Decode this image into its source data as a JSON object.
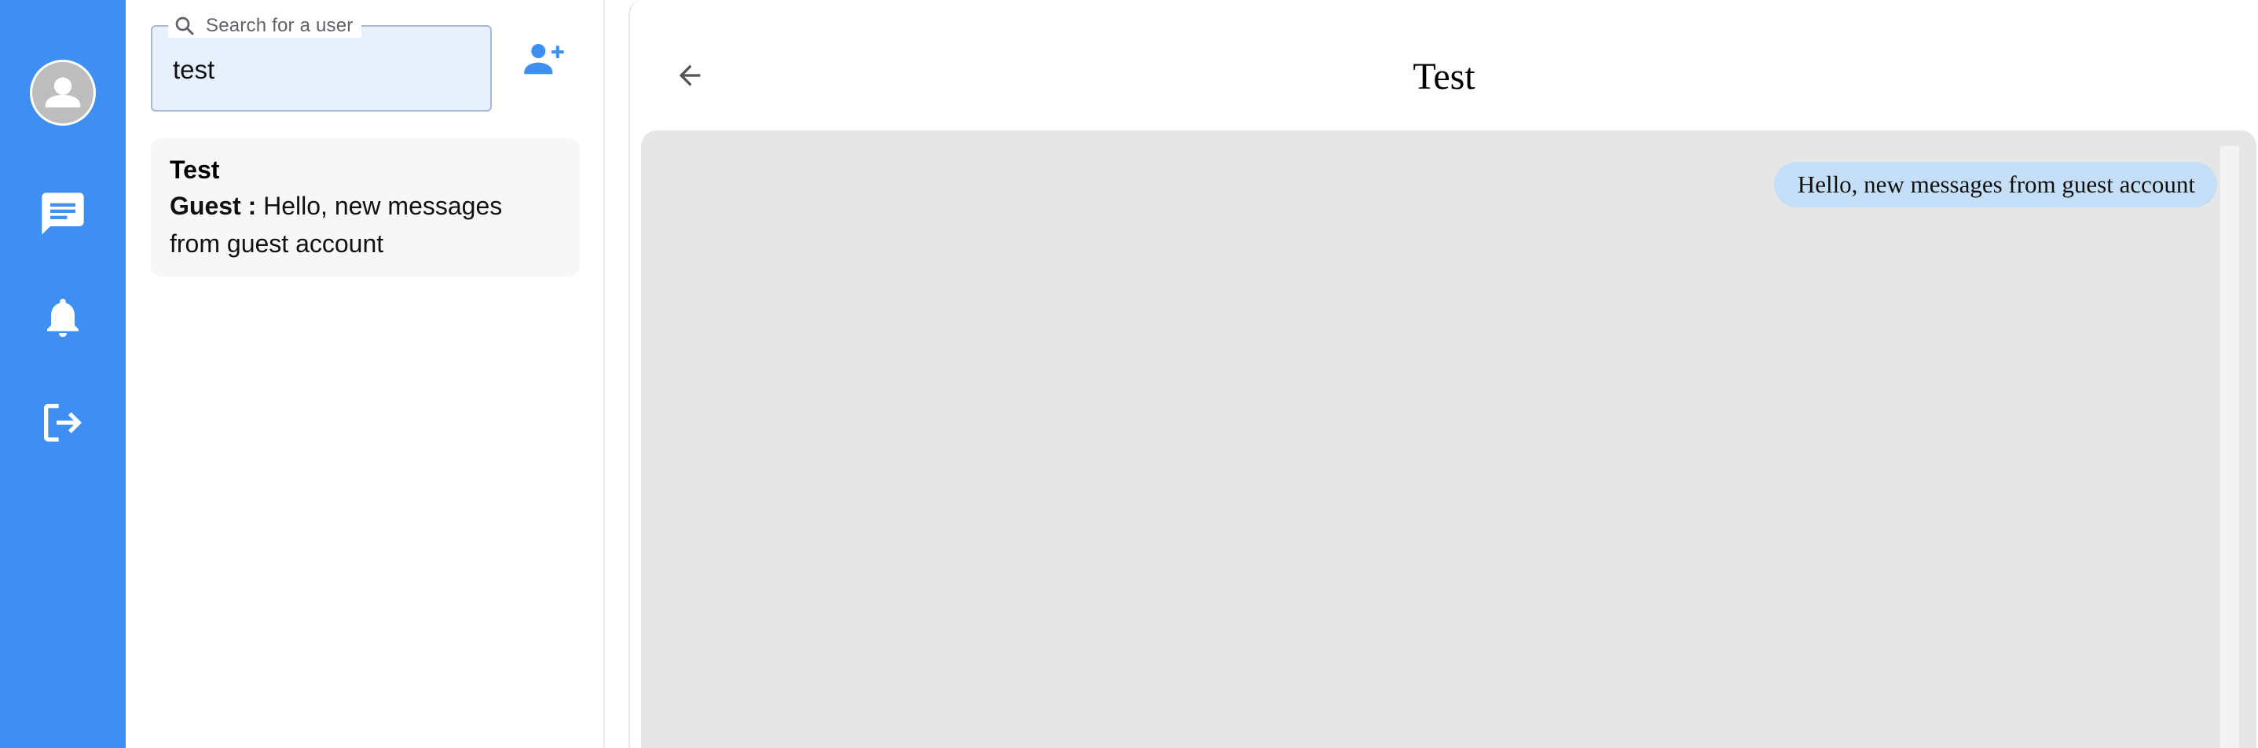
{
  "nav": {
    "items": [
      {
        "name": "profile",
        "icon": "person-icon"
      },
      {
        "name": "chats",
        "icon": "chat-icon"
      },
      {
        "name": "notifications",
        "icon": "bell-icon"
      },
      {
        "name": "logout",
        "icon": "logout-icon"
      }
    ],
    "accent_color": "#3f8ef1"
  },
  "search": {
    "placeholder": "Search for a user",
    "value": "test",
    "icon": "search-icon"
  },
  "add_user": {
    "icon": "add-user-icon"
  },
  "conversations": [
    {
      "name": "Test",
      "sender": "Guest :",
      "preview": "Hello, new messages from guest account"
    }
  ],
  "chat": {
    "title": "Test",
    "back_icon": "arrow-back-icon",
    "messages": [
      {
        "text": "Hello, new messages from guest account",
        "bubble_color": "#c4dff7"
      }
    ]
  }
}
